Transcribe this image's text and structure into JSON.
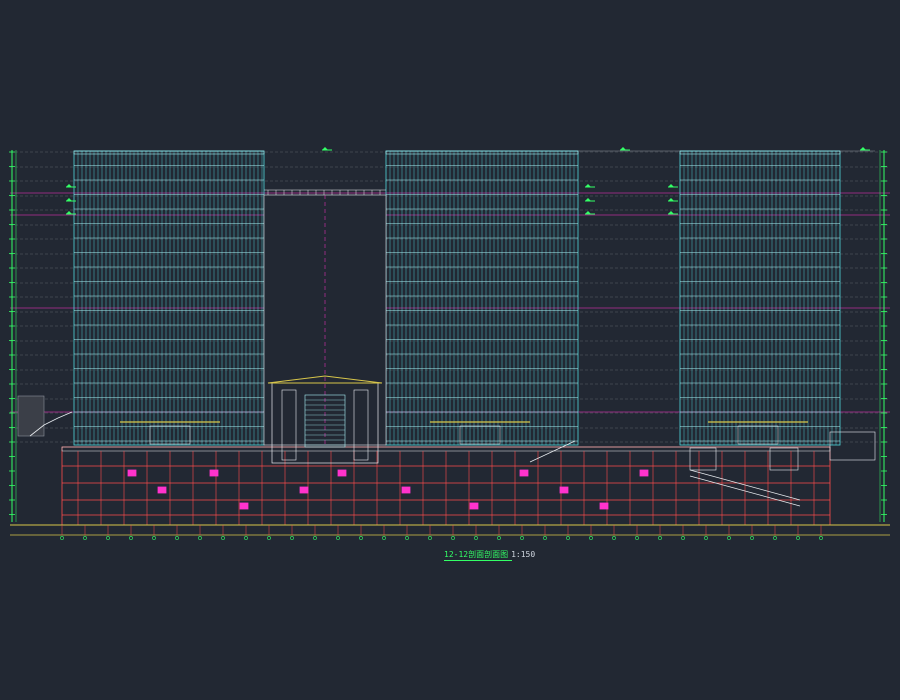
{
  "drawing": {
    "caption_title": "12-12剖面剖面图",
    "caption_scale": "1:150"
  },
  "colors": {
    "background": "#222833",
    "curtain_wall": "#4fd6dc",
    "curtain_wall_light": "#a8f2f5",
    "floor_line": "#b77cc9",
    "magenta_accent": "#ff33cc",
    "structure_red": "#ff4b4b",
    "annotation_green": "#33ff66",
    "ground_yellow": "#d8c64a",
    "white_detail": "#e8ecf0"
  }
}
